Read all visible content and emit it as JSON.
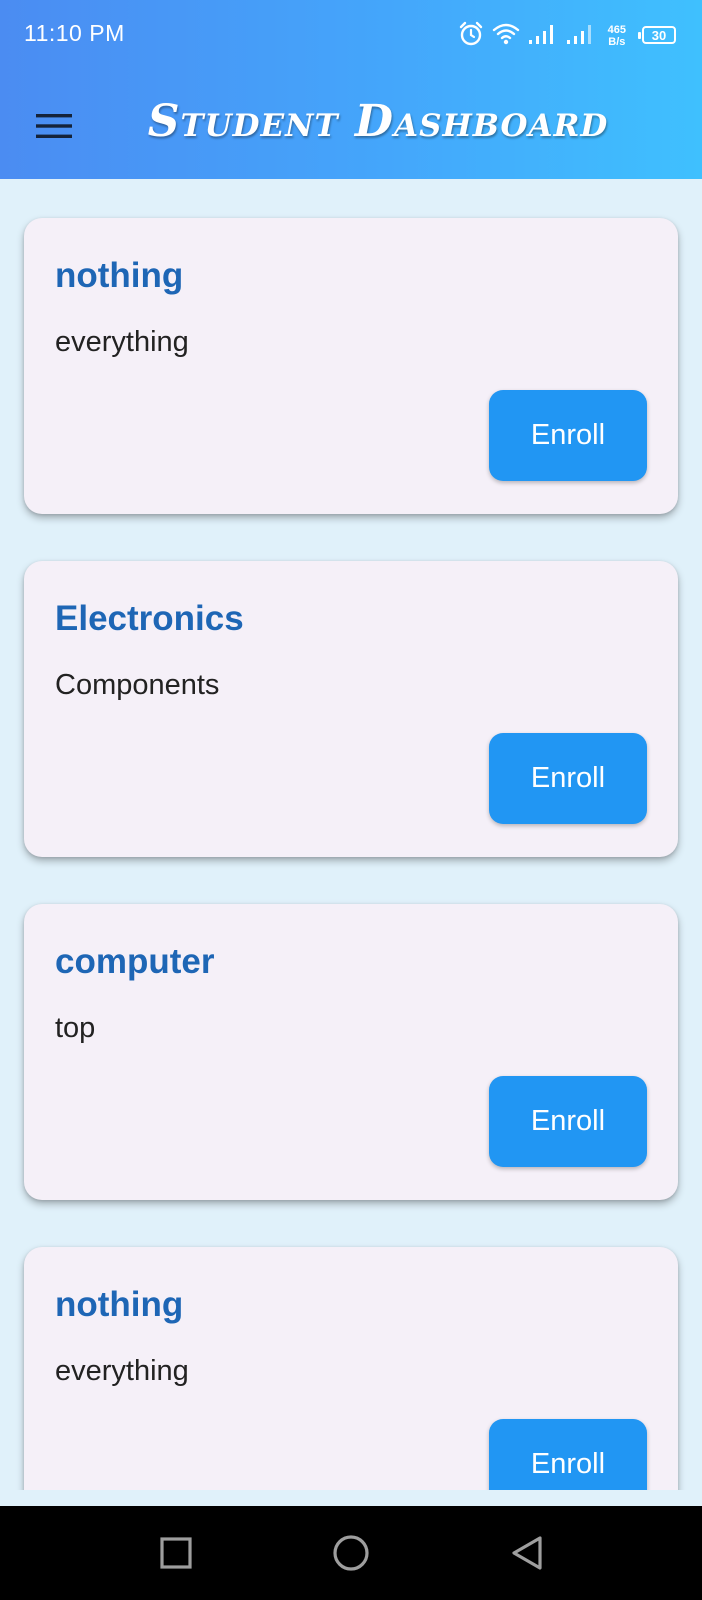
{
  "status_bar": {
    "time": "11:10 PM",
    "net_speed_value": "465",
    "net_speed_unit": "B/s",
    "battery_level": "30",
    "icons": [
      "alarm-icon",
      "wifi-icon",
      "signal-icon",
      "signal-icon"
    ]
  },
  "app_bar": {
    "title": "Student Dashboard",
    "menu_icon": "hamburger-menu-icon"
  },
  "courses": [
    {
      "title": "nothing",
      "description": "everything",
      "button_label": "Enroll"
    },
    {
      "title": "Electronics",
      "description": "Components",
      "button_label": "Enroll"
    },
    {
      "title": "computer",
      "description": "top",
      "button_label": "Enroll"
    },
    {
      "title": "nothing",
      "description": "everything",
      "button_label": "Enroll"
    }
  ],
  "nav_bar": {
    "buttons": [
      "recent-apps-icon",
      "home-icon",
      "back-icon"
    ]
  },
  "colors": {
    "header_gradient_start": "#4b8cf2",
    "header_gradient_end": "#3fc0fe",
    "page_background": "#e0f1fa",
    "card_background": "#f5f0f8",
    "card_title": "#1e66b5",
    "button": "#2196f3"
  }
}
